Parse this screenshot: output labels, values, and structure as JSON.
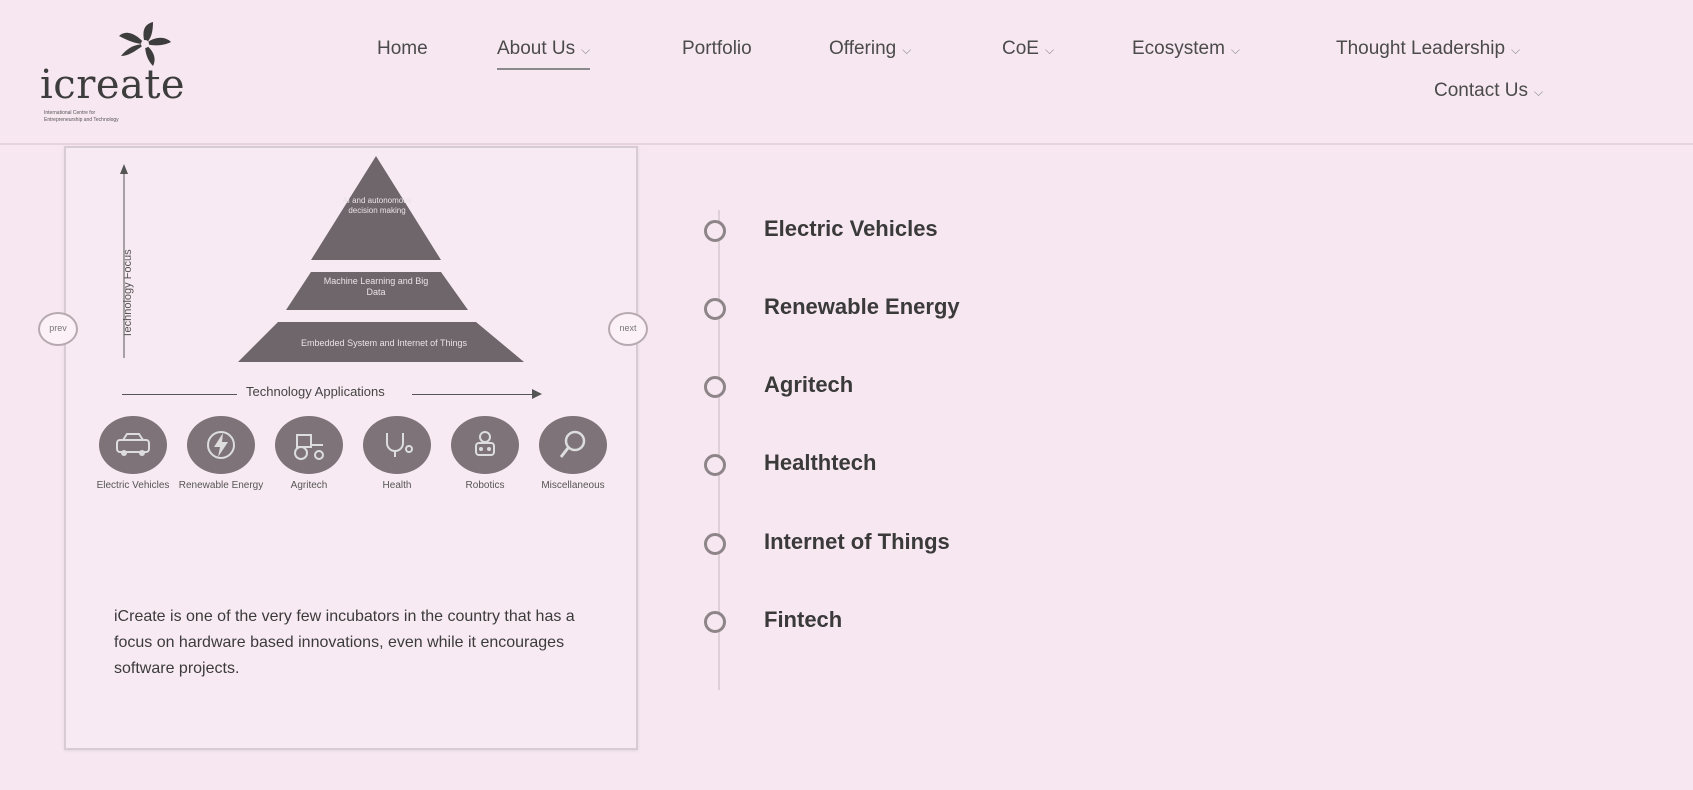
{
  "header": {
    "logo": {
      "name": "icreate",
      "tagline_line1": "International Centre for",
      "tagline_line2": "Entrepreneurship and Technology"
    },
    "nav": [
      {
        "label": "Home",
        "has_dropdown": false,
        "active": false
      },
      {
        "label": "About Us",
        "has_dropdown": true,
        "active": true
      },
      {
        "label": "Portfolio",
        "has_dropdown": false,
        "active": false
      },
      {
        "label": "Offering",
        "has_dropdown": true,
        "active": false
      },
      {
        "label": "CoE",
        "has_dropdown": true,
        "active": false
      },
      {
        "label": "Ecosystem",
        "has_dropdown": true,
        "active": false
      },
      {
        "label": "Thought Leadership",
        "has_dropdown": true,
        "active": false
      },
      {
        "label": "Contact Us",
        "has_dropdown": true,
        "active": false
      }
    ],
    "chevron": "⌵"
  },
  "card": {
    "y_axis_label": "Technology Focus",
    "prev_label": "prev",
    "next_label": "next",
    "pyramid_levels": [
      "AI and autonomous decision making",
      "Machine Learning and Big Data",
      "Embedded System and Internet of Things"
    ],
    "tech_apps_label": "Technology Applications",
    "apps": [
      {
        "label": "Electric Vehicles",
        "icon": "car-icon"
      },
      {
        "label": "Renewable Energy",
        "icon": "energy-icon"
      },
      {
        "label": "Agritech",
        "icon": "tractor-icon"
      },
      {
        "label": "Health",
        "icon": "stethoscope-icon"
      },
      {
        "label": "Robotics",
        "icon": "robot-icon"
      },
      {
        "label": "Miscellaneous",
        "icon": "magnifier-icon"
      }
    ],
    "description": "iCreate is one of the very few incubators in the country that has a focus on hardware based innovations, even while it encourages software projects."
  },
  "timeline": [
    "Electric Vehicles",
    "Renewable Energy",
    "Agritech",
    "Healthtech",
    "Internet of Things",
    "Fintech"
  ],
  "colors": {
    "background": "#f7e7f0",
    "pyramid": "#6e666a",
    "icon_circle": "#7d7378",
    "text": "#3a3a3a"
  }
}
